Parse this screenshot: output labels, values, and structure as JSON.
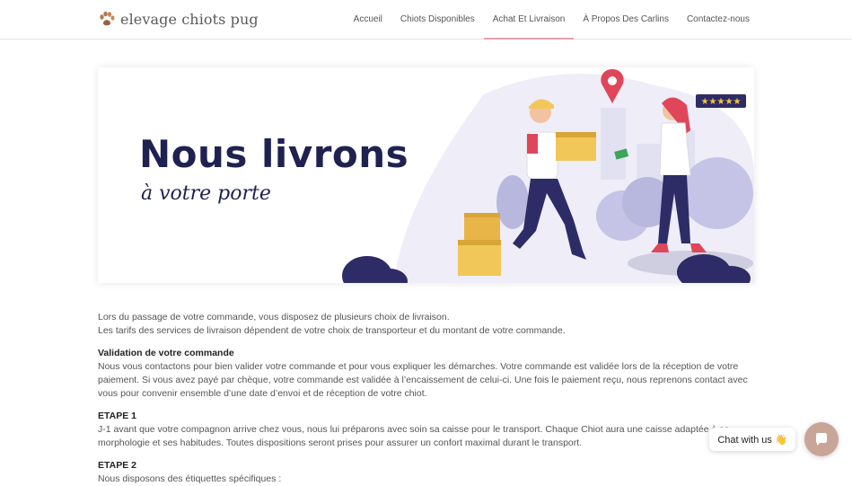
{
  "header": {
    "logo_text": "elevage chiots pug",
    "logo_icon": "paw-icon",
    "nav": [
      {
        "label": "Accueil"
      },
      {
        "label": "Chiots Disponibles"
      },
      {
        "label": "Achat Et Livraison",
        "active": true
      },
      {
        "label": "À Propos Des Carlins"
      },
      {
        "label": "Contactez-nous"
      }
    ],
    "accent_color": "#e7a1a8"
  },
  "banner": {
    "title": "Nous livrons",
    "subtitle": "à votre porte",
    "stars": "★★★★★"
  },
  "content": {
    "intro1": "Lors du passage de votre commande, vous disposez de plusieurs choix de livraison.",
    "intro2": "Les tarifs des services de livraison dépendent de votre choix de transporteur et du montant de votre commande.",
    "h_validation": "Validation de votre commande",
    "p_validation": "Nous vous contactons pour bien valider votre commande et pour vous expliquer les démarches. Votre commande est validée lors de la réception de votre paiement. Si vous avez payé par chèque, votre commande est validée à l’encaissement de celui-ci. Une fois le paiement reçu, nous reprenons contact avec vous pour convenir ensemble d’une date d’envoi et de réception de votre chiot.",
    "h_etape1": "ETAPE 1",
    "p_etape1": "J-1 avant que votre compagnon arrive chez vous, nous lui préparons avec soin sa caisse pour le transport. Chaque Chiot aura une caisse adaptée à sa morphologie et ses habitudes. Toutes dispositions seront prises pour assurer un confort maximal durant le transport.",
    "h_etape2": "ETAPE 2",
    "p_etape2": "Nous disposons des étiquettes spécifiques :"
  },
  "chat": {
    "label": "Chat with us 👋",
    "button_icon": "chat-icon",
    "button_color": "#c9a598"
  }
}
